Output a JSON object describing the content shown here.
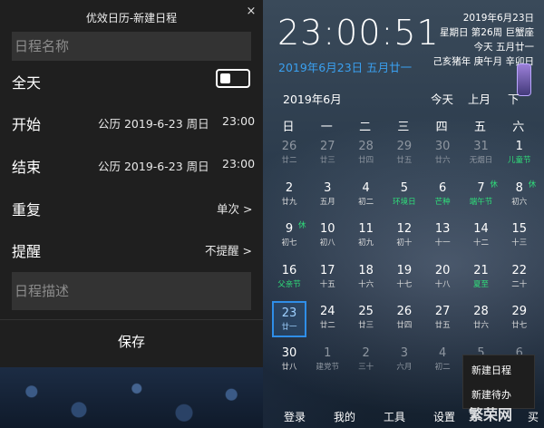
{
  "dialog": {
    "title": "优效日历-新建日程",
    "close_glyph": "×",
    "name_placeholder": "日程名称",
    "allday_label": "全天",
    "start_label": "开始",
    "start_date": "公历 2019-6-23 周日",
    "start_time": "23:00",
    "end_label": "结束",
    "end_date": "公历 2019-6-23 周日",
    "end_time": "23:00",
    "repeat_label": "重复",
    "repeat_value": "单次 >",
    "remind_label": "提醒",
    "remind_value": "不提醒 >",
    "desc_placeholder": "日程描述",
    "save_label": "保存",
    "allday_on": false
  },
  "header": {
    "clock": "23:00:51",
    "date_link": "2019年6月23日 五月廿一",
    "info": [
      "2019年6月23日",
      "星期日 第26周 巨蟹座",
      "今天 五月廿一",
      "己亥猪年 庚午月 辛卯日"
    ]
  },
  "calendar": {
    "month_label": "2019年6月",
    "nav": {
      "today": "今天",
      "prev": "上月",
      "next": "下"
    },
    "weekdays": [
      "日",
      "一",
      "二",
      "三",
      "四",
      "五",
      "六"
    ],
    "days": [
      {
        "d": "26",
        "l": "廿二",
        "other": true
      },
      {
        "d": "27",
        "l": "廿三",
        "other": true
      },
      {
        "d": "28",
        "l": "廿四",
        "other": true
      },
      {
        "d": "29",
        "l": "廿五",
        "other": true
      },
      {
        "d": "30",
        "l": "廿六",
        "other": true
      },
      {
        "d": "31",
        "l": "无烟日",
        "other": true
      },
      {
        "d": "1",
        "l": "儿童节",
        "fest": true
      },
      {
        "d": "2",
        "l": "廿九"
      },
      {
        "d": "3",
        "l": "五月"
      },
      {
        "d": "4",
        "l": "初二"
      },
      {
        "d": "5",
        "l": "环境日",
        "fest": true
      },
      {
        "d": "6",
        "l": "芒种",
        "fest": true
      },
      {
        "d": "7",
        "l": "端午节",
        "fest": true,
        "rest": "休"
      },
      {
        "d": "8",
        "l": "初六",
        "rest": "休"
      },
      {
        "d": "9",
        "l": "初七",
        "rest": "休"
      },
      {
        "d": "10",
        "l": "初八"
      },
      {
        "d": "11",
        "l": "初九"
      },
      {
        "d": "12",
        "l": "初十"
      },
      {
        "d": "13",
        "l": "十一"
      },
      {
        "d": "14",
        "l": "十二"
      },
      {
        "d": "15",
        "l": "十三"
      },
      {
        "d": "16",
        "l": "父亲节",
        "fest": true
      },
      {
        "d": "17",
        "l": "十五"
      },
      {
        "d": "18",
        "l": "十六"
      },
      {
        "d": "19",
        "l": "十七"
      },
      {
        "d": "20",
        "l": "十八"
      },
      {
        "d": "21",
        "l": "夏至",
        "fest": true
      },
      {
        "d": "22",
        "l": "二十"
      },
      {
        "d": "23",
        "l": "廿一",
        "today": true
      },
      {
        "d": "24",
        "l": "廿二"
      },
      {
        "d": "25",
        "l": "廿三"
      },
      {
        "d": "26",
        "l": "廿四"
      },
      {
        "d": "27",
        "l": "廿五"
      },
      {
        "d": "28",
        "l": "廿六"
      },
      {
        "d": "29",
        "l": "廿七"
      },
      {
        "d": "30",
        "l": "廿八"
      },
      {
        "d": "1",
        "l": "建党节",
        "other": true
      },
      {
        "d": "2",
        "l": "三十",
        "other": true
      },
      {
        "d": "3",
        "l": "六月",
        "other": true
      },
      {
        "d": "4",
        "l": "初二",
        "other": true
      },
      {
        "d": "5",
        "l": "",
        "other": true
      },
      {
        "d": "6",
        "l": "",
        "other": true
      }
    ]
  },
  "context_menu": {
    "items": [
      "新建日程",
      "新建待办"
    ]
  },
  "bottom_nav": {
    "items": [
      "登录",
      "我的",
      "工具",
      "设置"
    ],
    "extra": "买"
  },
  "watermark": "繁荣网",
  "colors": {
    "accent": "#2f8ee8",
    "festival": "#2fe07a",
    "dialog_bg": "#1f1f1f"
  }
}
